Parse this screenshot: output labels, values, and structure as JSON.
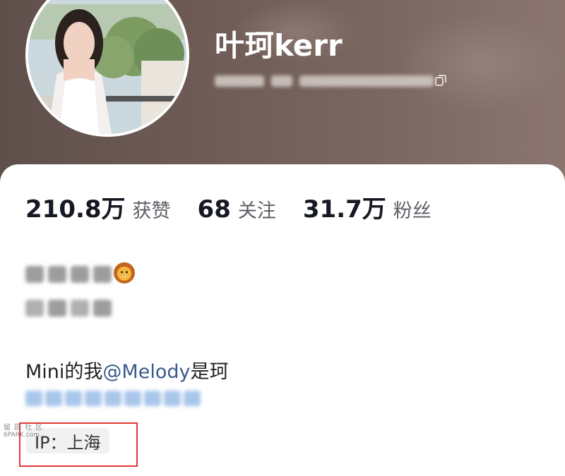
{
  "profile": {
    "nickname": "叶珂kerr",
    "avatar_icon": "avatar-photo"
  },
  "stats": [
    {
      "value": "210.8万",
      "label": "获赞"
    },
    {
      "value": "68",
      "label": "关注"
    },
    {
      "value": "31.7万",
      "label": "粉丝"
    }
  ],
  "bio": {
    "emoji": "🦁",
    "line_prefix": "Mini的我",
    "mention": "@Melody",
    "line_suffix": "是珂"
  },
  "ip": {
    "label": "IP：上海"
  },
  "watermark": {
    "cn": "留园社区",
    "en": "6PARK.com"
  },
  "colors": {
    "header": "#6e5b55",
    "mention": "#3a5a8c",
    "highlight": "#e53935",
    "blurred_link": "#a9c7eb"
  }
}
